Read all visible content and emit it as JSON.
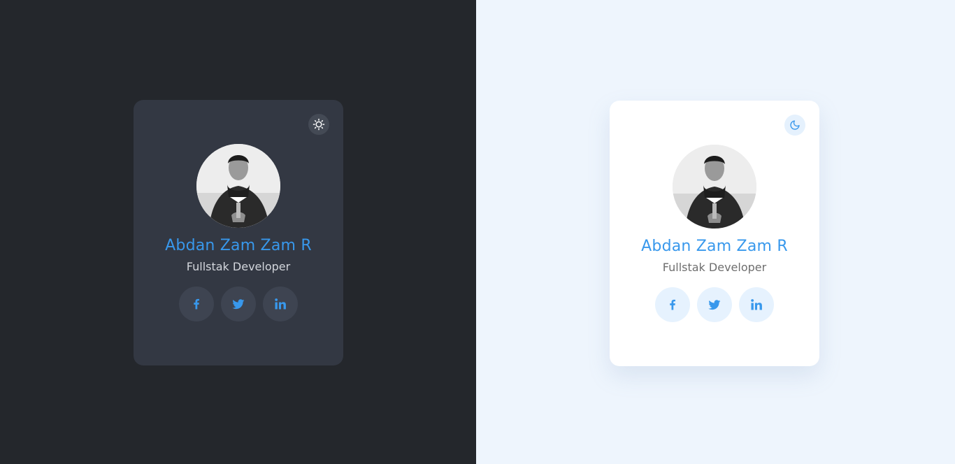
{
  "colors": {
    "accent": "#3898ec",
    "dark_background": "#24272c",
    "dark_card": "#333843",
    "light_background": "#eef5fd",
    "light_card": "#ffffff"
  },
  "cards": {
    "dark": {
      "theme_toggle_icon": "sun-icon",
      "name": "Abdan Zam Zam R",
      "role": "Fullstak Developer",
      "socials": [
        "facebook-icon",
        "twitter-icon",
        "linkedin-icon"
      ]
    },
    "light": {
      "theme_toggle_icon": "moon-icon",
      "name": "Abdan Zam Zam R",
      "role": "Fullstak Developer",
      "socials": [
        "facebook-icon",
        "twitter-icon",
        "linkedin-icon"
      ]
    }
  }
}
